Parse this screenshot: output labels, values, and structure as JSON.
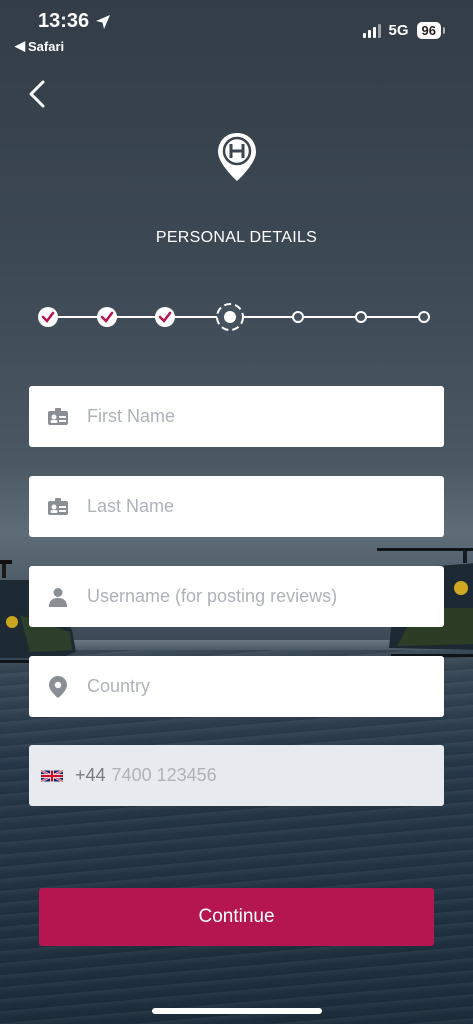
{
  "status_bar": {
    "time": "13:36",
    "back_app": "Safari",
    "network": "5G",
    "battery": "96"
  },
  "header": {
    "title": "PERSONAL DETAILS",
    "logo_letter": "H"
  },
  "stepper": {
    "total_steps": 7,
    "completed_steps": 3,
    "current_step": 4
  },
  "form": {
    "first_name_placeholder": "First Name",
    "last_name_placeholder": "Last Name",
    "username_placeholder": "Username (for posting reviews)",
    "country_placeholder": "Country",
    "phone_code": "+44",
    "phone_placeholder": "7400 123456"
  },
  "actions": {
    "continue_label": "Continue"
  },
  "colors": {
    "accent": "#b5164f",
    "check_color": "#b5164f"
  }
}
